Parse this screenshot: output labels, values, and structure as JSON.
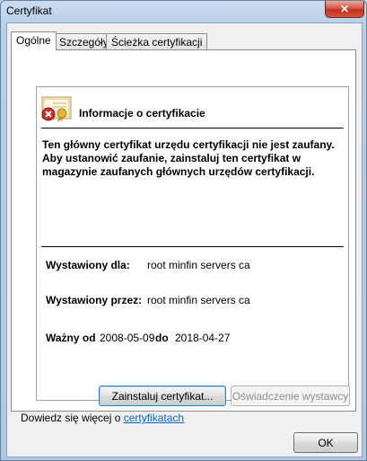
{
  "window": {
    "title": "Certyfikat",
    "close_glyph": "✕"
  },
  "tabs": [
    {
      "label": "Ogólne",
      "active": true
    },
    {
      "label": "Szczegóły",
      "active": false
    },
    {
      "label": "Ścieżka certyfikacji",
      "active": false
    }
  ],
  "info": {
    "icon": "certificate-error-icon",
    "title": "Informacje o certyfikacie",
    "warning": "Ten główny certyfikat urzędu certyfikacji nie jest zaufany. Aby ustanowić zaufanie, zainstaluj ten certyfikat w magazynie zaufanych głównych urzędów certyfikacji.",
    "issued_to_label": "Wystawiony dla:",
    "issued_to_value": "root minfin servers ca",
    "issued_by_label": "Wystawiony przez:",
    "issued_by_value": "root minfin servers ca",
    "valid_from_label": "Ważny od",
    "valid_from_value": "2008-05-09",
    "valid_to_label": "do",
    "valid_to_value": "2018-04-27"
  },
  "buttons": {
    "install": "Zainstaluj certyfikat...",
    "issuer_statement": "Oświadczenie wystawcy",
    "ok": "OK"
  },
  "learn_more": {
    "prefix": "Dowiedz się więcej o ",
    "link": "certyfikatach"
  },
  "colors": {
    "link": "#0066cc",
    "close_button": "#c9402c",
    "window_frame": "#b7cfe8"
  }
}
